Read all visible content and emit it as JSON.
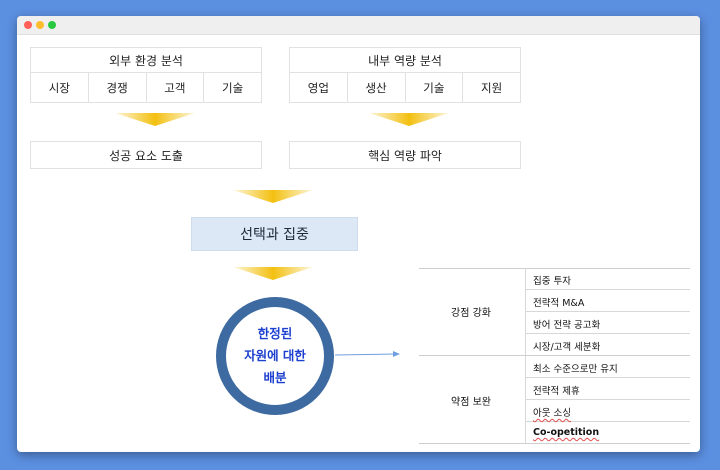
{
  "window": {
    "controls": {
      "close_color": "#ff5f57",
      "minimize_color": "#febc2e",
      "maximize_color": "#28c840"
    }
  },
  "external": {
    "title": "외부 환경 분석",
    "items": [
      "시장",
      "경쟁",
      "고객",
      "기술"
    ]
  },
  "internal": {
    "title": "내부 역량 분석",
    "items": [
      "영업",
      "생산",
      "기술",
      "지원"
    ]
  },
  "derive": {
    "success": "성공 요소 도출",
    "core": "핵심 역량 파악"
  },
  "focus": {
    "label": "선택과 집중"
  },
  "allocation": {
    "line1": "한정된",
    "line2": "자원에 대한",
    "line3": "배분"
  },
  "strategy": {
    "strengthen": {
      "label": "강점 강화",
      "items": [
        "집중 투자",
        "전략적 M&A",
        "방어 전략 공고화",
        "시장/고객 세분화"
      ]
    },
    "supplement": {
      "label": "약점 보완",
      "items": [
        "최소 수준으로만 유지",
        "전략적 제휴",
        "아웃 소싱",
        "Co-opetition"
      ]
    }
  },
  "colors": {
    "arrow": "#f3c010",
    "focus_fill": "#dce8f5",
    "ring": "#3d6aa0",
    "allocation_text": "#1c3fd0",
    "connector": "#6f9fe0"
  }
}
